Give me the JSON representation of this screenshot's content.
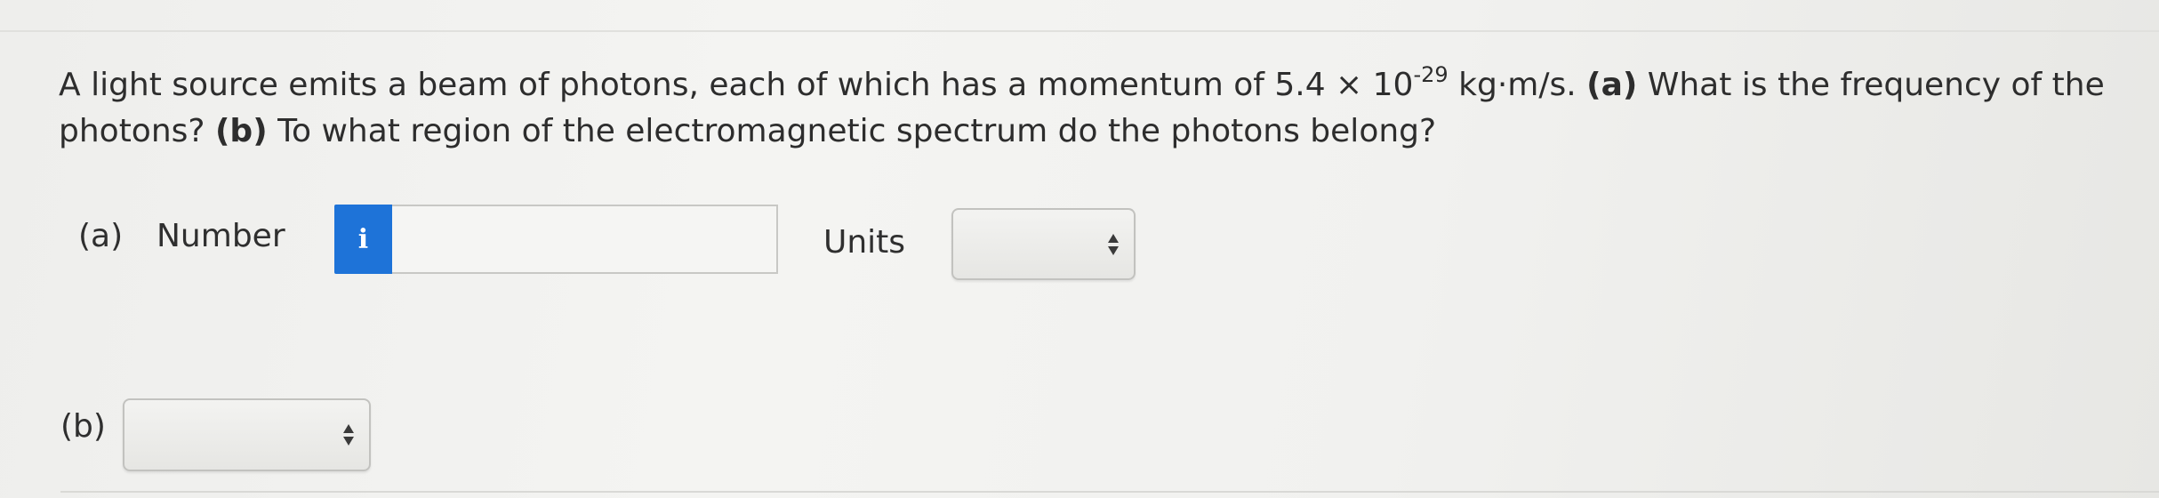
{
  "question": {
    "line1_pre": "A light source emits a beam of photons, each of which has a momentum of 5.4 × 10",
    "exponent": "-29",
    "line1_post": " kg·m/s.",
    "part_a_tag": "(a)",
    "part_a_text": " What is the frequency of the photons?",
    "part_b_tag": "(b)",
    "part_b_text": " To what region of the electromagnetic spectrum do the photons belong?"
  },
  "part_a": {
    "label": "(a)",
    "number_label": "Number",
    "info_icon_text": "i",
    "number_value": "",
    "units_label": "Units",
    "units_selected": ""
  },
  "part_b": {
    "label": "(b)",
    "region_selected": ""
  },
  "colors": {
    "info_button": "#1e73d8",
    "text": "#2d2d2d"
  }
}
